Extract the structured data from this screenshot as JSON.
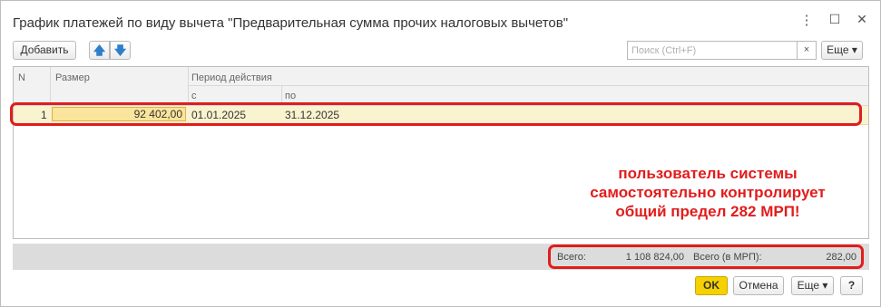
{
  "window": {
    "title": "График платежей по виду вычета \"Предварительная сумма прочих налоговых вычетов\"",
    "more_icon": "⋮",
    "maximize_icon": "☐",
    "close_icon": "✕"
  },
  "toolbar": {
    "add_label": "Добавить",
    "up_icon": "🡅",
    "down_icon": "🡇",
    "search_placeholder": "Поиск (Ctrl+F)",
    "search_clear_icon": "×",
    "more_label": "Еще ▾"
  },
  "table": {
    "headers": {
      "n": "N",
      "size": "Размер",
      "period": "Период действия",
      "from": "с",
      "to": "по"
    },
    "rows": [
      {
        "n": "1",
        "size": "92 402,00",
        "from": "01.01.2025",
        "to": "31.12.2025"
      }
    ]
  },
  "annotation": {
    "line1": "пользователь системы",
    "line2": "самостоятельно контролирует",
    "line3": "общий предел 282 МРП!"
  },
  "totals": {
    "total_label": "Всего:",
    "total_value": "1 108 824,00",
    "mrp_label": "Всего (в МРП):",
    "mrp_value": "282,00"
  },
  "buttons": {
    "ok_label": "OK",
    "cancel_label": "Отмена",
    "more_label": "Еще ▾",
    "help_label": "?"
  },
  "colors": {
    "highlight": "#e21c1c",
    "ok_button": "#f5d100",
    "selected_row": "#faf3d0"
  }
}
